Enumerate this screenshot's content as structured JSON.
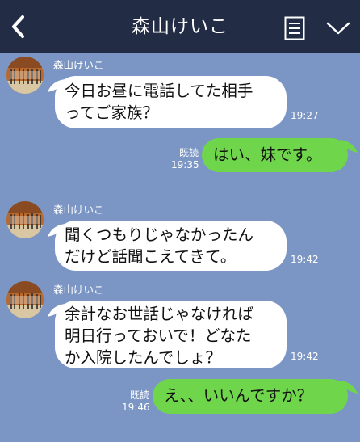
{
  "header": {
    "back_icon": "chevron-left-icon",
    "title": "森山けいこ",
    "menu_icon": "memo-list-icon",
    "collapse_icon": "chevron-down-icon",
    "colors": {
      "header_bg": "#222c44",
      "chat_bg": "#7b96c4",
      "outgoing_bubble": "#6fd64b",
      "incoming_bubble": "#ffffff"
    }
  },
  "messages": [
    {
      "direction": "incoming",
      "sender": "森山けいこ",
      "text": "今日お昼に電話してた相手\nってご家族？",
      "time": "19:27"
    },
    {
      "direction": "outgoing",
      "read_label": "既読",
      "text": "はい、妹です。",
      "time": "19:35"
    },
    {
      "direction": "incoming",
      "sender": "森山けいこ",
      "text": "聞くつもりじゃなかったん\nだけど話聞こえてきて。",
      "time": "19:42"
    },
    {
      "direction": "incoming",
      "sender": "森山けいこ",
      "text": "余計なお世話じゃなければ\n明日行っておいで！どなた\nか入院したんでしょ？",
      "time": "19:42"
    },
    {
      "direction": "outgoing",
      "read_label": "既読",
      "text": "え、、いいんですか？",
      "time": "19:46"
    }
  ]
}
